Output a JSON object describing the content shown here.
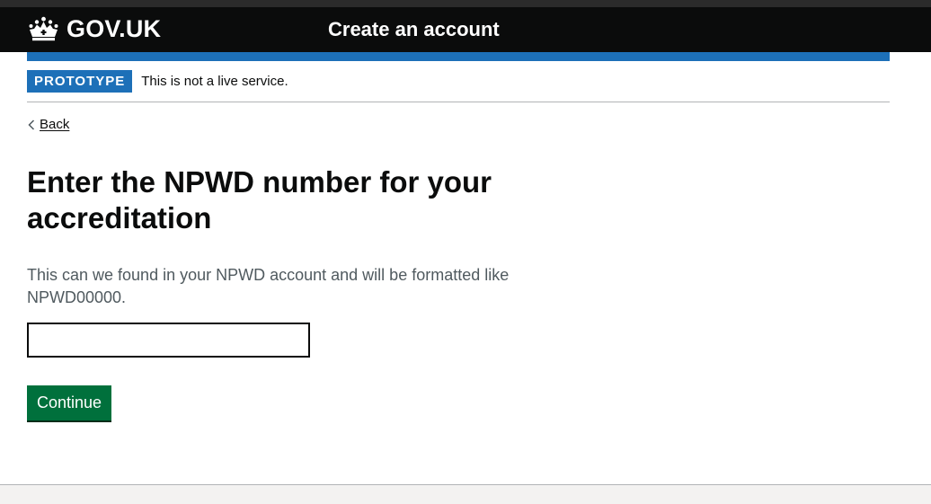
{
  "header": {
    "logo_text": "GOV.UK",
    "logo_icon": "crown-icon",
    "service_name": "Create an account"
  },
  "phase_banner": {
    "tag": "PROTOTYPE",
    "text": "This is not a live service."
  },
  "back_link": {
    "label": "Back",
    "icon": "chevron-left-icon"
  },
  "main": {
    "heading": "Enter the NPWD number for your accreditation",
    "hint": "This can we found in your NPWD account and will be formatted like NPWD00000.",
    "input_value": "",
    "continue_label": "Continue"
  },
  "colors": {
    "header_bg": "#0b0c0c",
    "brand_blue": "#1d70b8",
    "button_green": "#00703c",
    "hint_grey": "#505a5f",
    "footer_bg": "#f3f2f1"
  }
}
